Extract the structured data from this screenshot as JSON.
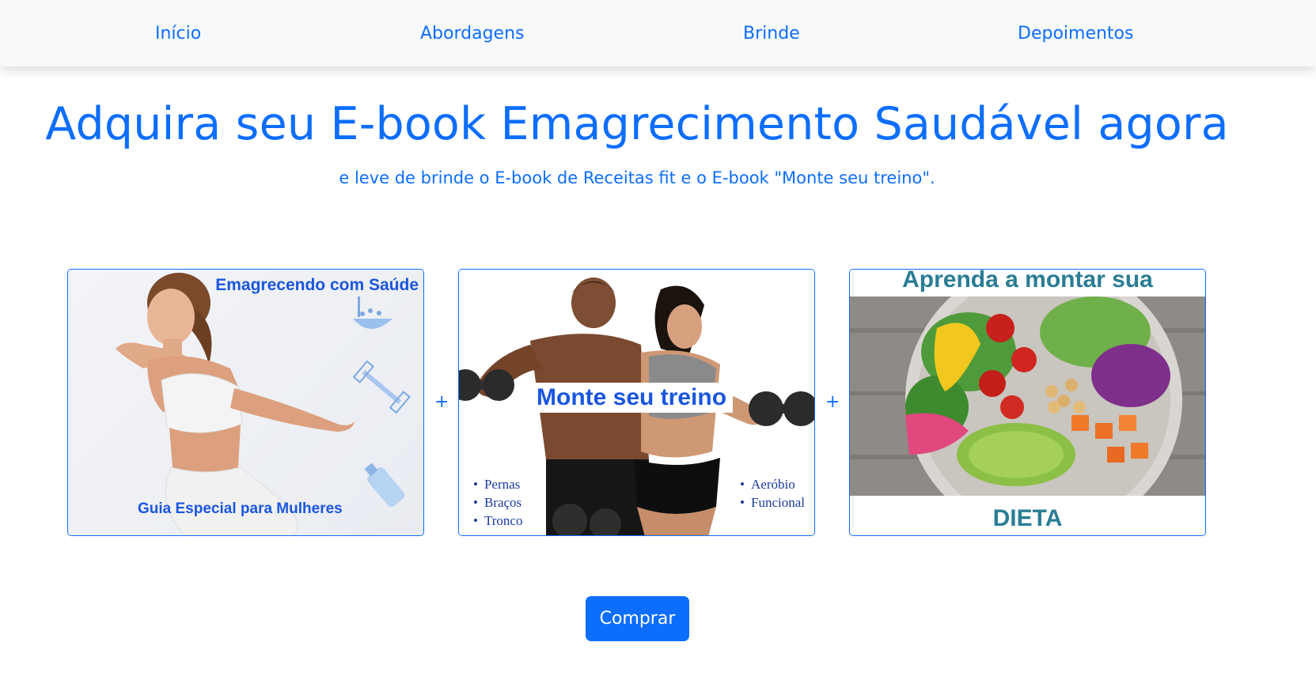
{
  "nav": {
    "items": [
      {
        "label": "Início"
      },
      {
        "label": "Abordagens"
      },
      {
        "label": "Brinde"
      },
      {
        "label": "Depoimentos"
      }
    ]
  },
  "hero": {
    "title": "Adquira seu E-book Emagrecimento Saudável agora",
    "subtitle": "e leve de brinde o E-book de Receitas fit e o E-book \"Monte seu treino\"."
  },
  "cards": [
    {
      "title": "Emagrecendo com Saúde",
      "footer": "Guia Especial para Mulheres"
    },
    {
      "title": "Monte seu treino",
      "list_left": [
        "Pernas",
        "Braços",
        "Tronco"
      ],
      "list_right": [
        "Aeróbio",
        "Funcional"
      ]
    },
    {
      "title": "Aprenda a montar sua",
      "footer": "DIETA"
    }
  ],
  "separator": "+",
  "buy_button": "Comprar",
  "colors": {
    "primary": "#0d6efd",
    "navbar_bg": "#f8f9fa",
    "diet_teal": "#2a7d94"
  }
}
